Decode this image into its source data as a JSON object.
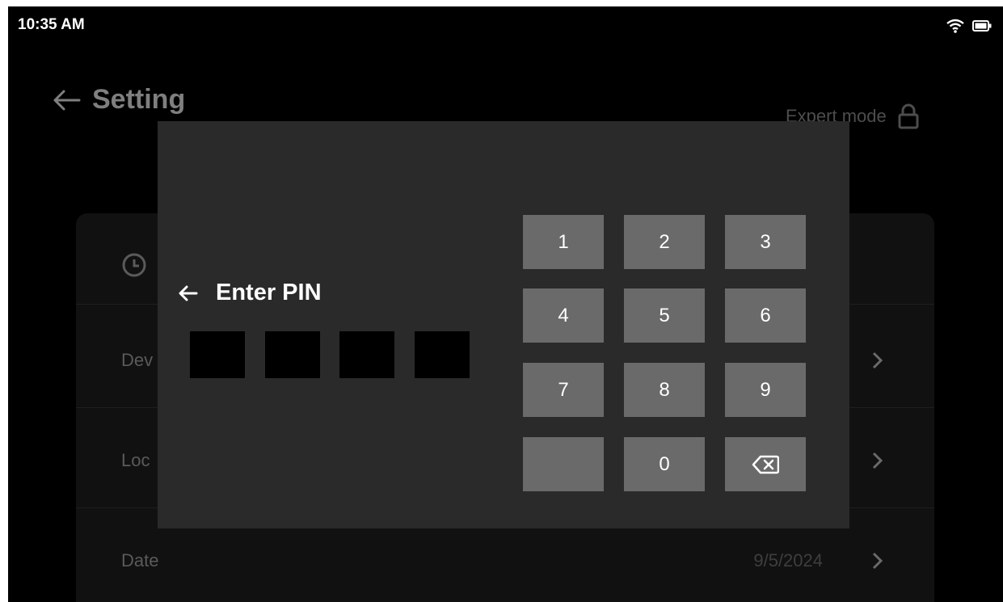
{
  "status_bar": {
    "time": "10:35 AM",
    "icons": [
      "wifi-icon",
      "battery-icon"
    ]
  },
  "header": {
    "title": "Setting",
    "back_icon": "arrow-left-icon"
  },
  "expert_mode": {
    "label": "Expert mode",
    "icon": "lock-icon"
  },
  "settings_list": {
    "rows": [
      {
        "label": "Dev"
      },
      {
        "label": "Loc"
      },
      {
        "label": "Date",
        "value": "9/5/2024"
      }
    ]
  },
  "pin_dialog": {
    "title": "Enter PIN",
    "back_icon": "arrow-left-icon",
    "digits_entered": 0,
    "pin_length": 4,
    "keys": [
      "1",
      "2",
      "3",
      "4",
      "5",
      "6",
      "7",
      "8",
      "9",
      "",
      "0",
      "backspace-icon"
    ]
  },
  "colors": {
    "screen_bg": "#000000",
    "dialog_bg": "#2a2a2b",
    "key_bg": "#6a6a6a",
    "text_primary": "#ffffff",
    "text_dim": "#7f7f7f"
  }
}
